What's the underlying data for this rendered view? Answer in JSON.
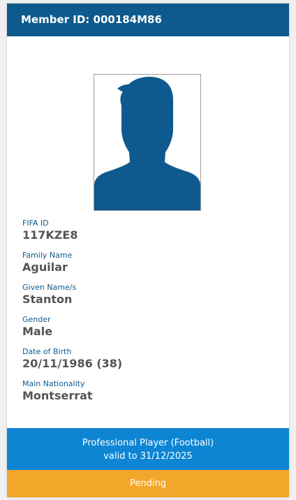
{
  "header": {
    "title": "Member ID: 000184M86"
  },
  "photo": {
    "icon": "person-silhouette-icon",
    "color": "#0e5a8e"
  },
  "fields": [
    {
      "label": "FIFA ID",
      "value": "117KZE8"
    },
    {
      "label": "Family Name",
      "value": "Aguilar"
    },
    {
      "label": "Given Name/s",
      "value": "Stanton"
    },
    {
      "label": "Gender",
      "value": "Male"
    },
    {
      "label": "Date of Birth",
      "value": "20/11/1986 (38)"
    },
    {
      "label": "Main Nationality",
      "value": "Montserrat"
    }
  ],
  "registration": {
    "role": "Professional Player (Football)",
    "validity": "valid to 31/12/2025",
    "status": "Pending"
  },
  "colors": {
    "header": "#0e5a8e",
    "role_band": "#0d85d3",
    "status_band": "#f2a62a"
  }
}
